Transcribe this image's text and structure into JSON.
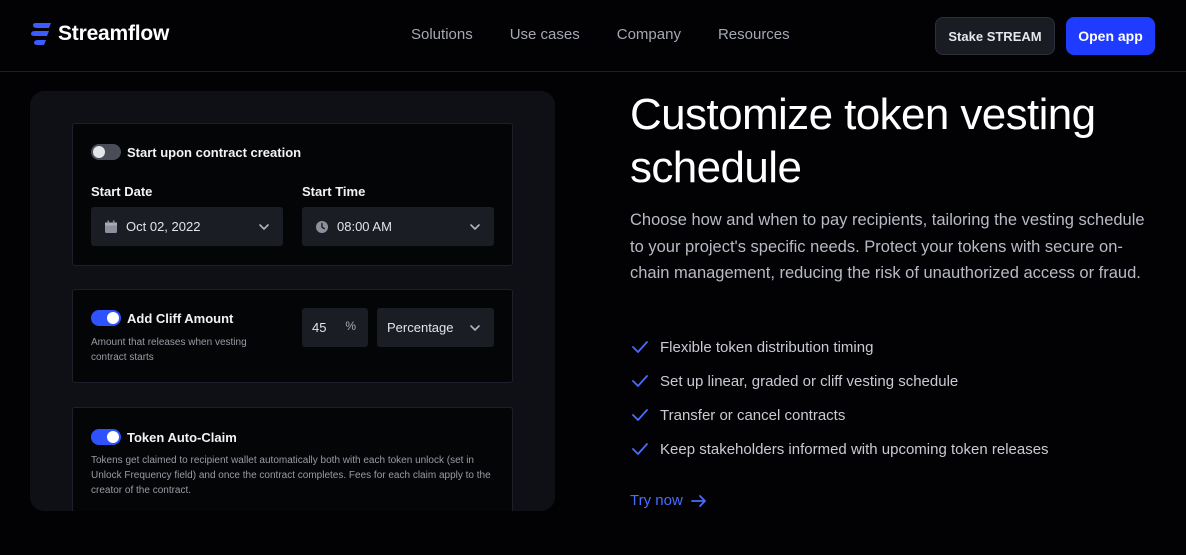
{
  "header": {
    "brand": "Streamflow",
    "nav": [
      "Solutions",
      "Use cases",
      "Company",
      "Resources"
    ],
    "stake_label": "Stake STREAM",
    "open_label": "Open app"
  },
  "panel": {
    "start_upon_creation": {
      "label": "Start upon contract creation",
      "enabled": false
    },
    "start_date": {
      "label": "Start Date",
      "value": "Oct 02, 2022"
    },
    "start_time": {
      "label": "Start Time",
      "value": "08:00 AM"
    },
    "cliff": {
      "label": "Add Cliff Amount",
      "enabled": true,
      "description": "Amount that releases when vesting contract starts",
      "amount": "45",
      "unit_symbol": "%",
      "type": "Percentage"
    },
    "auto_claim": {
      "label": "Token Auto-Claim",
      "enabled": true,
      "description": "Tokens get claimed to recipient wallet automatically both with each token unlock (set in Unlock Frequency field) and once the contract completes. Fees for each claim apply to the creator of the contract."
    }
  },
  "hero": {
    "title": "Customize token vesting schedule",
    "description": "Choose how and when to pay recipients, tailoring the vesting schedule to your project's specific needs. Protect your tokens with secure on-chain management, reducing the risk of unauthorized access or fraud.",
    "features": [
      "Flexible token distribution timing",
      "Set up linear, graded or cliff vesting schedule",
      "Transfer or cancel contracts",
      "Keep stakeholders informed with upcoming token releases"
    ],
    "cta": "Try now"
  },
  "colors": {
    "accent": "#1f3bff",
    "link": "#4a6bff",
    "check": "#4a6bff"
  }
}
